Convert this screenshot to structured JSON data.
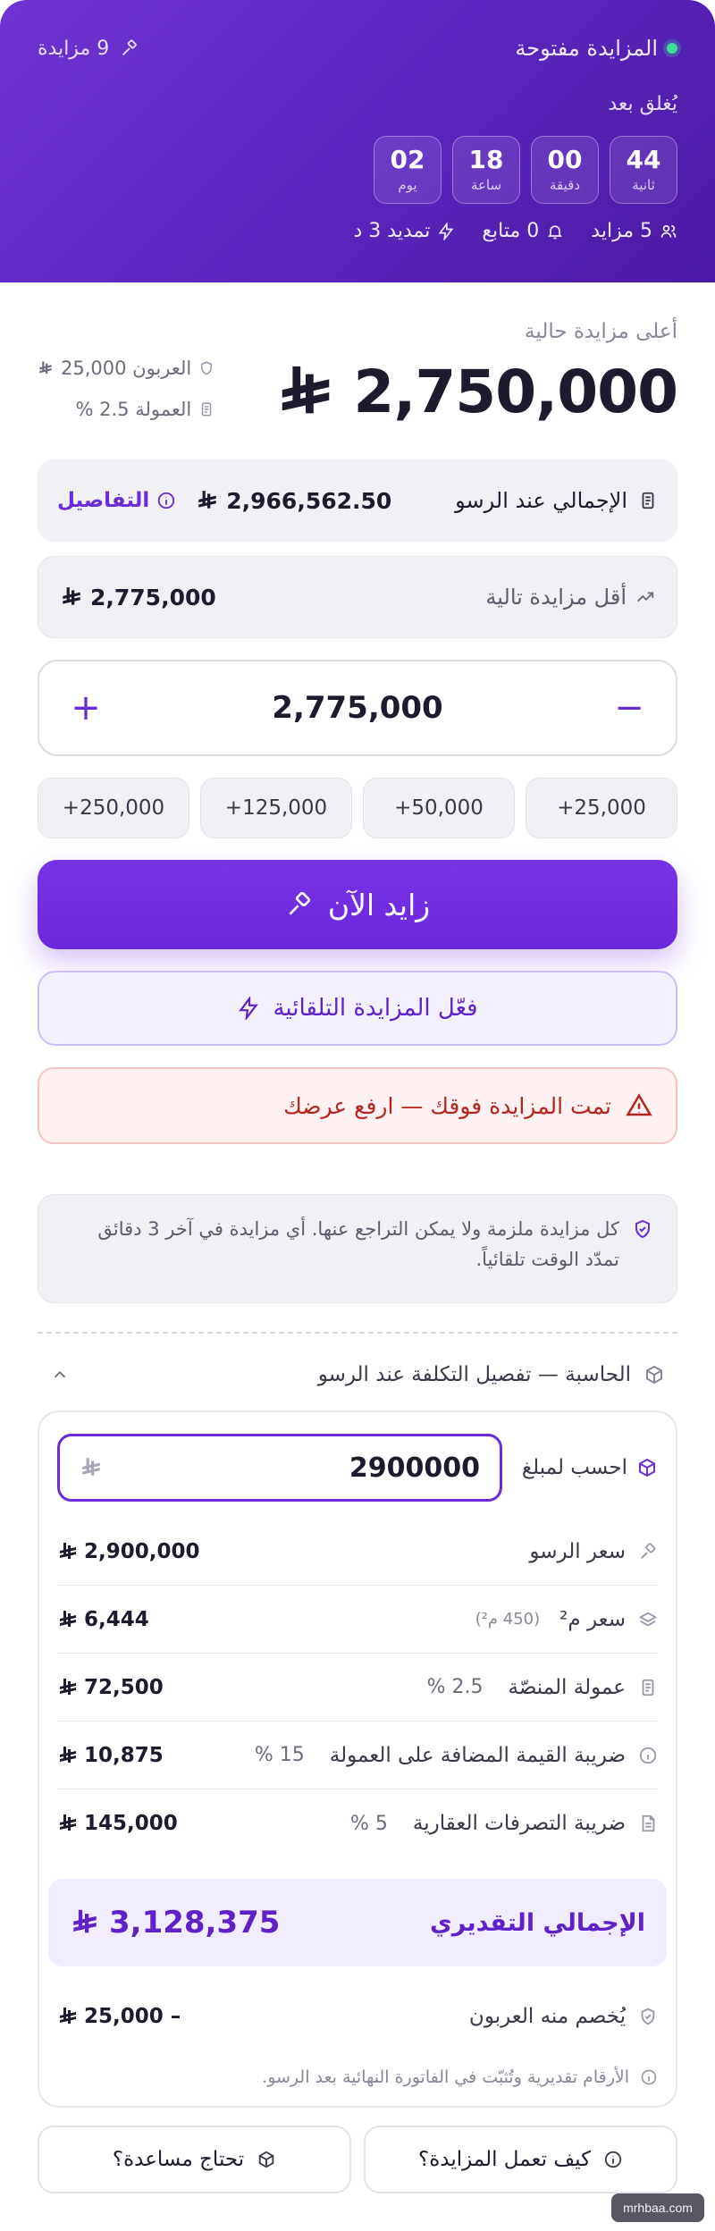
{
  "header": {
    "status": "المزايدة مفتوحة",
    "bids_count": "9 مزايدة",
    "closes_label": "يُغلق بعد",
    "countdown": [
      {
        "value": "44",
        "unit": "ثانية"
      },
      {
        "value": "00",
        "unit": "دقيقة"
      },
      {
        "value": "18",
        "unit": "ساعة"
      },
      {
        "value": "02",
        "unit": "يوم"
      }
    ],
    "stats": {
      "bidders": "5 مزايد",
      "followers": "0 متابع",
      "extension": "تمديد 3 د"
    }
  },
  "current": {
    "label": "أعلى مزايدة حالية",
    "amount": "2,750,000",
    "deposit": "العربون 25,000",
    "commission": "العمولة 2.5 %"
  },
  "total_on_award": {
    "label": "الإجمالي عند الرسو",
    "amount": "2,966,562.50",
    "details": "التفاصيل"
  },
  "min_next": {
    "label": "أقل مزايدة تالية",
    "amount": "2,775,000"
  },
  "stepper": {
    "value": "2,775,000",
    "plus": "+",
    "minus": "−"
  },
  "quick_increments": [
    "+25,000",
    "+50,000",
    "+125,000",
    "+250,000"
  ],
  "bid_button": "زايد الآن",
  "auto_bid_button": "فعّل المزايدة التلقائية",
  "alert": "تمت المزايدة فوقك — ارفع عرضك",
  "note": "كل مزايدة ملزمة ولا يمكن التراجع عنها. أي مزايدة في آخر 3 دقائق تمدّد الوقت تلقائياً.",
  "calculator": {
    "title": "الحاسبة — تفصيل التكلفة عند الرسو",
    "input_label": "احسب لمبلغ",
    "input_value": "2900000",
    "rows": [
      {
        "label": "سعر الرسو",
        "sub": "",
        "pct": "",
        "amount": "2,900,000"
      },
      {
        "label": "سعر م²",
        "sub": "(450 م²)",
        "pct": "",
        "amount": "6,444"
      },
      {
        "label": "عمولة المنصّة",
        "sub": "",
        "pct": "2.5 %",
        "amount": "72,500"
      },
      {
        "label": "ضريبة القيمة المضافة على العمولة",
        "sub": "",
        "pct": "15 %",
        "amount": "10,875"
      },
      {
        "label": "ضريبة التصرفات العقارية",
        "sub": "",
        "pct": "5 %",
        "amount": "145,000"
      }
    ],
    "estimated_total_label": "الإجمالي التقديري",
    "estimated_total": "3,128,375",
    "deduct_label": "يُخصم منه العربون",
    "deduct_amount": "25,000 –",
    "disclaimer": "الأرقام تقديرية وتُثبّت في الفاتورة النهائية بعد الرسو."
  },
  "help": {
    "how_it_works": "كيف تعمل المزايدة؟",
    "need_help": "تحتاج مساعدة؟"
  },
  "watermark": "mrhbaa.com",
  "colors": {
    "brand": "#6a2bd8",
    "header_gradient_start": "#6e34d4",
    "header_gradient_end": "#4b1aa3",
    "alert": "#b3261e",
    "status_dot": "#3ddc97"
  }
}
